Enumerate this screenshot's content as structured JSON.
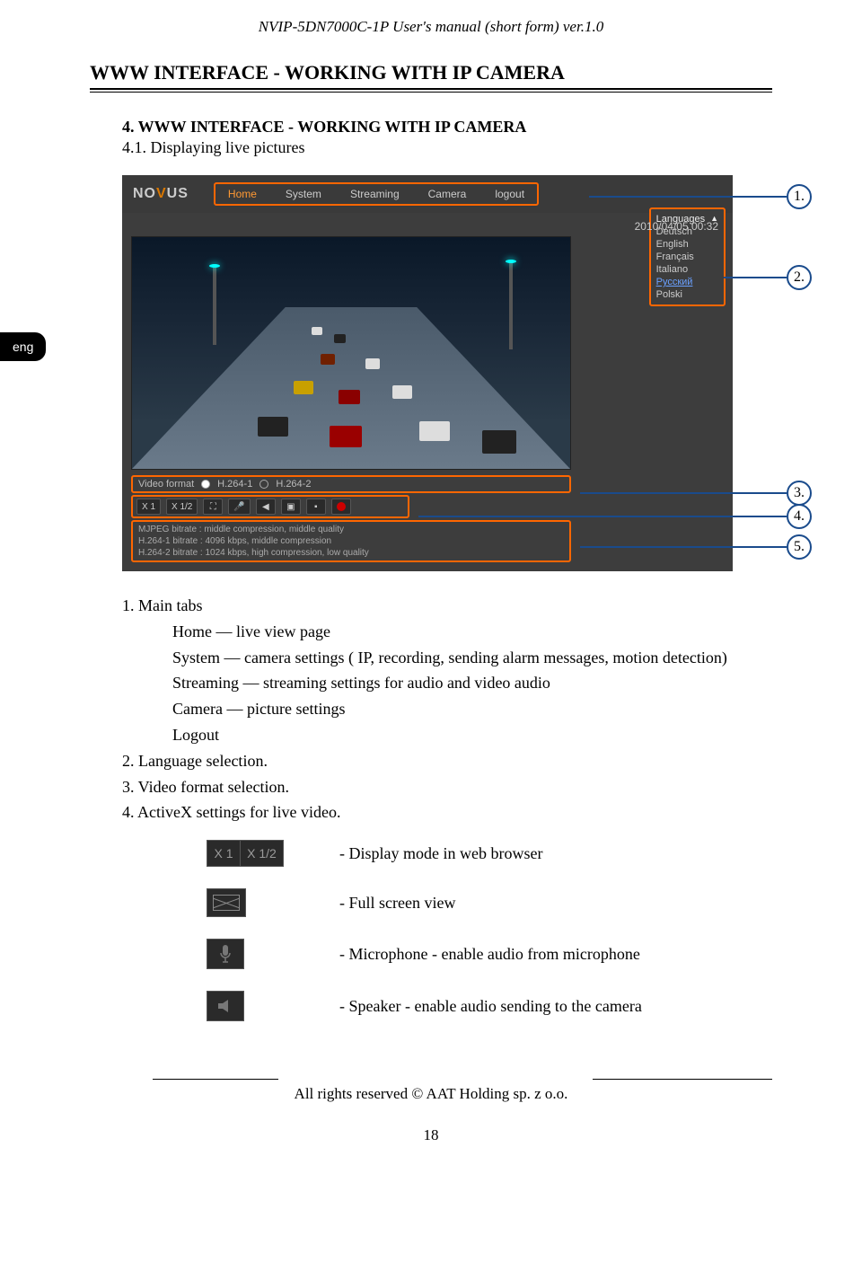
{
  "header": {
    "manual_title": "NVIP-5DN7000C-1P  User's manual (short form) ver.1.0"
  },
  "section": {
    "title": "WWW INTERFACE - WORKING WITH IP CAMERA",
    "h4": "4. WWW INTERFACE - WORKING WITH IP CAMERA",
    "h41": "4.1. Displaying live pictures"
  },
  "eng_tab": "eng",
  "screenshot": {
    "logo_a": "NO",
    "logo_v": "V",
    "logo_b": "US",
    "nav": {
      "home": "Home",
      "system": "System",
      "streaming": "Streaming",
      "camera": "Camera",
      "logout": "logout"
    },
    "timestamp": "2010/04/05 00:32",
    "lang": {
      "header": "Languages",
      "deutsch": "Deutsch",
      "english": "English",
      "francais": "Français",
      "italiano": "Italiano",
      "russian": "Русский",
      "polski": "Polski"
    },
    "vf": {
      "label": "Video format",
      "h2641": "H.264-1",
      "h2642": "H.264-2"
    },
    "ctrl": {
      "x1": "X 1",
      "x12": "X 1/2"
    },
    "bitrate": {
      "l1": "MJPEG bitrate : middle compression, middle quality",
      "l2": "H.264-1 bitrate : 4096 kbps, middle compression",
      "l3": "H.264-2 bitrate : 1024 kbps, high compression, low quality"
    }
  },
  "callouts": {
    "n1": "1.",
    "n2": "2.",
    "n3": "3.",
    "n4": "4.",
    "n5": "5."
  },
  "body": {
    "l1": "1. Main tabs",
    "home": "Home — live view page",
    "system": "System — camera settings  ( IP, recording, sending alarm messages, motion detection)",
    "streaming": "Streaming —  streaming settings for audio and video audio",
    "camera": "Camera — picture settings",
    "logout": "Logout",
    "l2": "2. Language selection.",
    "l3": "3. Video format selection.",
    "l4": "4. ActiveX settings for live video."
  },
  "icons": {
    "x1": "X 1",
    "x12": "X 1/2",
    "display_mode": "- Display mode in web browser",
    "fullscreen": "- Full screen view",
    "mic": "- Microphone - enable audio from microphone",
    "speaker": "- Speaker - enable audio sending to the camera"
  },
  "footer": {
    "rights": "All rights reserved © AAT Holding sp. z o.o.",
    "page": "18"
  }
}
